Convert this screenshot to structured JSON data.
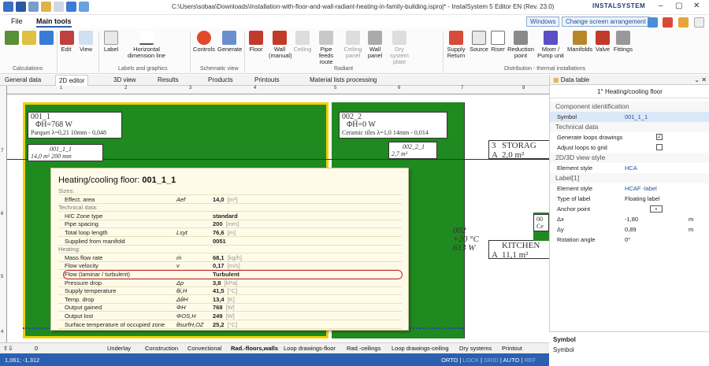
{
  "window": {
    "title": "C:\\Users\\sobaa\\Downloads\\Installation-with-floor-and-wall-radiant-heating-in-family-building.isproj* - InstalSystem 5 Editor EN (Rev. 23.0)",
    "brand": "INSTALSYSTEM"
  },
  "menu": {
    "file": "File",
    "main_tools": "Main tools",
    "windows": "Windows",
    "change_arrangement": "Change screen arrangement"
  },
  "ribbon": {
    "edit": "Edit",
    "view": "View",
    "label": "Label",
    "horizontal_dimension": "Horizontal dimension line",
    "controls": "Controls",
    "generate": "Generate",
    "floor": "Floor",
    "wall_manual": "Wall (manual)",
    "ceiling": "Ceiling",
    "pipe_feeds": "Pipe feeds route",
    "ceiling_panel": "Ceiling panel",
    "wall_panel": "Wall panel",
    "dry_system_plate": "Dry system plate",
    "supply_return": "Supply Return",
    "source": "Source",
    "riser": "Riser",
    "reduction_point": "Reduction point",
    "mixer_pump": "Mixer / Pump unit",
    "manifolds": "Manifolds",
    "valve": "Valve",
    "fittings": "Fittings",
    "groups": {
      "calculations": "Calculations",
      "labels_graphics": "Labels and graphics",
      "schematic_view": "Schematic view",
      "radiant": "Radiant",
      "distribution": "Distribution - thermal installations"
    }
  },
  "doc_tabs": [
    "General data",
    "2D editor",
    "3D view",
    "Results",
    "Products",
    "Printouts",
    "Material lists processing"
  ],
  "ruler": {
    "h_ticks": [
      "1",
      "2",
      "3",
      "4",
      "5",
      "6",
      "7",
      "8"
    ],
    "v_ticks": [
      "7",
      "6",
      "5",
      "4"
    ]
  },
  "canvas": {
    "zone1_name": "001_1",
    "zone1_power": "ΦH=768 W",
    "zone1_desc": "Parquet λ=0,21 10mm - 0,048",
    "zone1_loop": "001_1_1",
    "zone1_loop_detail": "14,0 m² 200 mm",
    "zone2_name": "002_2",
    "zone2_power": "ΦH=0 W",
    "zone2_desc": "Ceramic tiles λ=1,0 14mm - 0,014",
    "zone2_loop": "002_2_1",
    "zone2_loop_area": "2,7 m²",
    "storage_num": "3",
    "storage_name": "STORAG",
    "storage_letter": "A",
    "storage_area": "2,0 m²",
    "room_num": "002",
    "room_temp": "+20 °C",
    "room_power": "613 W",
    "kitchen_name": "KITCHEN",
    "kitchen_letter": "A",
    "kitchen_area": "11,1 m²",
    "side_label": "00",
    "side_label2": "Ce"
  },
  "popup": {
    "title_prefix": "Heating/cooling floor: ",
    "title_id": "001_1_1",
    "rows": [
      {
        "label": "Sizes:",
        "section": true
      },
      {
        "label": "Effect. area",
        "sym": "Aef",
        "value": "14,0",
        "unit": "[m²]"
      },
      {
        "label": "Technical data:",
        "section": true
      },
      {
        "label": "H/C Zone type",
        "sym": "",
        "value": "standard",
        "unit": ""
      },
      {
        "label": "Pipe spacing",
        "sym": "",
        "value": "200",
        "unit": "[mm]"
      },
      {
        "label": "Total loop length",
        "sym": "Lsyt",
        "value": "76,6",
        "unit": "[m]"
      },
      {
        "label": "Supplied from manifold",
        "sym": "",
        "value": "0051",
        "unit": ""
      },
      {
        "label": "Heating:",
        "section": true
      },
      {
        "label": "Mass flow rate",
        "sym": "ṁ",
        "value": "68,1",
        "unit": "[kg/h]"
      },
      {
        "label": "Flow velocity",
        "sym": "v",
        "value": "0,17",
        "unit": "[m/s]"
      },
      {
        "label": "Flow (laminar / turbulent)",
        "sym": "",
        "value": "Turbulent",
        "unit": ""
      },
      {
        "label": "Pressure drop",
        "sym": "Δp",
        "value": "3,8",
        "unit": "[kPa]"
      },
      {
        "label": "Supply temperature",
        "sym": "θi,H",
        "value": "41,5",
        "unit": "[°C]"
      },
      {
        "label": "Temp. drop",
        "sym": "ΔθH",
        "value": "13,4",
        "unit": "[K]"
      },
      {
        "label": "Output gained",
        "sym": "ΦH",
        "value": "768",
        "unit": "[W]"
      },
      {
        "label": "Output lost",
        "sym": "ΦOS,H",
        "value": "249",
        "unit": "[W]"
      },
      {
        "label": "Surface temperature of occupied zone",
        "sym": "θsurfH,OZ",
        "value": "25,2",
        "unit": "[°C]"
      }
    ]
  },
  "panel": {
    "title": "Data table",
    "heading": "1° Heating/cooling floor",
    "cat_component": "Component identification",
    "symbol_label": "Symbol",
    "symbol_value": "001_1_1",
    "cat_technical": "Technical data",
    "gen_loops": "Generate loops drawings",
    "adjust_loops": "Adjust loops to grid",
    "cat_view": "2D/3D view style",
    "element_style": "Element style",
    "element_style_value": "HCA",
    "cat_label": "Label[1]",
    "label_style": "Element style",
    "label_style_value": "HCAF -label",
    "type_label": "Type of label",
    "type_label_value": "Floating label",
    "anchor_point": "Anchor point",
    "dx_label": "Δx",
    "dx_value": "-1,80",
    "dy_label": "Δy",
    "dy_value": "0,89",
    "unit_m": "m",
    "rotation": "Rotation angle",
    "rotation_value": "0°",
    "foot_title": "Symbol",
    "foot_desc": "Symbol"
  },
  "layers": {
    "level": "0",
    "items": [
      "Underlay",
      "Construction",
      "Convectional",
      "Rad.-floors,walls",
      "Loop drawings-floor",
      "Rad.-ceilings",
      "Loop drawings-ceiling",
      "Dry systems",
      "Printout"
    ]
  },
  "status": {
    "coords": "1,061; -1,312",
    "orto": "ORTO",
    "lock": "LOCK",
    "grid": "GRID",
    "auto": "AUTO",
    "ref": "REF"
  }
}
